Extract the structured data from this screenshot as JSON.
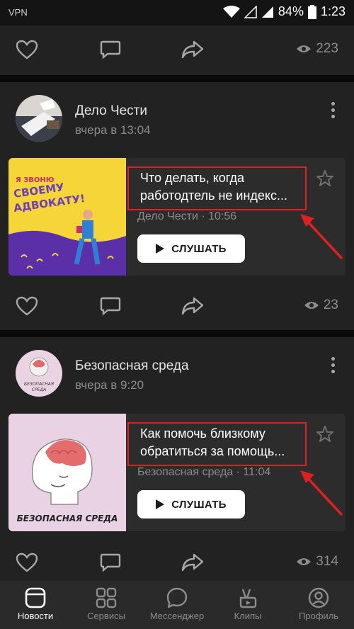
{
  "status": {
    "vpn": "VPN",
    "battery": "84%",
    "time": "1:23"
  },
  "top_post": {
    "views": "223"
  },
  "posts": [
    {
      "author": "Дело Чести",
      "time": "вчера в 13:04",
      "podcast": {
        "title_line1": "Что делать, когда",
        "title_line2": "работодтель не индекс...",
        "meta": "Дело Чести · 10:56",
        "listen_label": "СЛУШАТЬ",
        "cover_text": [
          "Я ЗВОНЮ",
          "СВОЕМУ",
          "АДВОКАТУ!"
        ]
      },
      "views": "23"
    },
    {
      "author": "Безопасная среда",
      "time": "вчера в 9:20",
      "podcast": {
        "title_line1": "Как помочь близкому",
        "title_line2": "обратиться за помощь...",
        "meta": "Безопасная среда · 11:04",
        "listen_label": "СЛУШАТЬ",
        "cover_text": [
          "БЕЗОПАСНАЯ СРЕДА"
        ]
      },
      "avatar_text": [
        "БЕЗОПАСНАЯ",
        "СРЕДА"
      ],
      "views": "314"
    }
  ],
  "tabbar": {
    "items": [
      {
        "label": "Новости",
        "active": true
      },
      {
        "label": "Сервисы",
        "active": false
      },
      {
        "label": "Мессенджер",
        "active": false
      },
      {
        "label": "Клипы",
        "active": false
      },
      {
        "label": "Профиль",
        "active": false
      }
    ]
  },
  "colors": {
    "highlight": "#e02020",
    "accent_yellow": "#f5d538",
    "muted": "#8c8c8c"
  }
}
